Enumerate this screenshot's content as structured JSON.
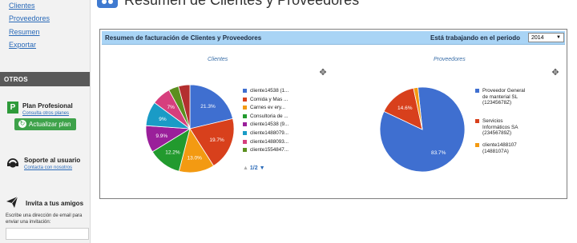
{
  "sidebar": {
    "links": [
      "Clientes",
      "Proveedores",
      "Resumen",
      "Exportar"
    ],
    "otros": "OTROS",
    "plan": {
      "icon_letter": "P",
      "title": "Plan Profesional",
      "link": "Consulta otros planes",
      "button": "Actualizar plan"
    },
    "support": {
      "title": "Soporte al usuario",
      "link": "Contacta con nosotros"
    },
    "invite": {
      "title": "Invita a tus amigos",
      "desc": "Escribe una dirección de email para enviar una invitación:",
      "placeholder": ""
    }
  },
  "header": {
    "title": "Resumen de Clientes y Proveedores"
  },
  "panel": {
    "title": "Resumen de facturación de Clientes y Proveedores",
    "period_label": "Está trabajando en el periodo",
    "period_value": "2014"
  },
  "clientes": {
    "title": "Clientes",
    "pager": "1/2",
    "slices": [
      {
        "label": "cliente14538 (1...",
        "value": 21.3,
        "pct": "21.3%",
        "color": "#3f6fd0"
      },
      {
        "label": "Comida y Mas ...",
        "value": 19.7,
        "pct": "19.7%",
        "color": "#d8401c"
      },
      {
        "label": "Carnes ev ery...",
        "value": 13.0,
        "pct": "13.0%",
        "color": "#f39a12"
      },
      {
        "label": "Consultoria de ...",
        "value": 12.2,
        "pct": "12.2%",
        "color": "#229a2e"
      },
      {
        "label": "cliente14538 (9...",
        "value": 9.9,
        "pct": "9.9%",
        "color": "#9a1f9a"
      },
      {
        "label": "cliente1488079...",
        "value": 9.0,
        "pct": "9%",
        "color": "#1a9bc6"
      },
      {
        "label": "cliente1488093...",
        "value": 7.0,
        "pct": "7%",
        "color": "#d63f7d"
      },
      {
        "label": "cliente1554847...",
        "value": 3.7,
        "pct": "",
        "color": "#5b8f1f"
      },
      {
        "label": "",
        "value": 4.2,
        "pct": "",
        "color": "#b32f2f"
      }
    ]
  },
  "proveedores": {
    "title": "Proveedores",
    "slices": [
      {
        "label": "Proveedor General de manterial SL (12345678Z)",
        "value": 83.7,
        "pct": "83.7%",
        "color": "#3f6fd0"
      },
      {
        "label": "Servicios Informáticos SA (23456789Z)",
        "value": 14.6,
        "pct": "14.6%",
        "color": "#d8401c"
      },
      {
        "label": "cliente1488107 (1488107A)",
        "value": 1.7,
        "pct": "",
        "color": "#f39a12"
      }
    ]
  }
}
